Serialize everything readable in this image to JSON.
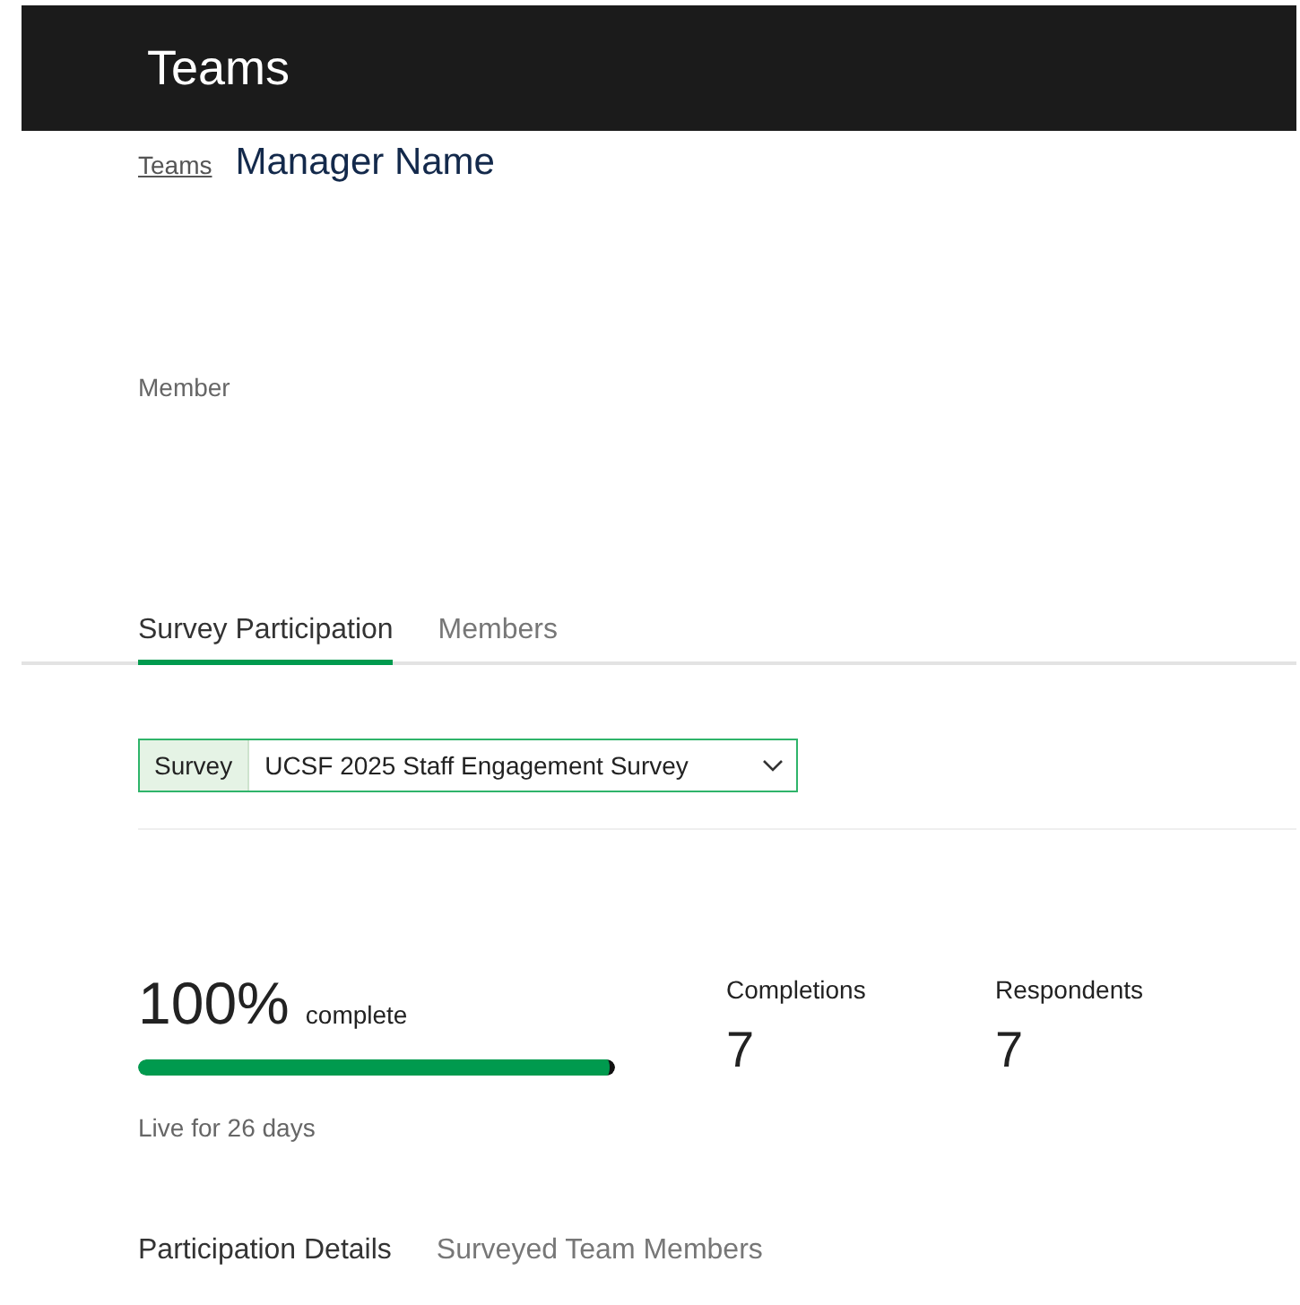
{
  "header": {
    "title": "Teams"
  },
  "breadcrumb": {
    "link": "Teams",
    "title": "Manager Name"
  },
  "member_label": "Member",
  "tabs": [
    {
      "label": "Survey Participation",
      "selected": true
    },
    {
      "label": "Members",
      "selected": false
    }
  ],
  "survey_select": {
    "label": "Survey",
    "value": "UCSF 2025 Staff Engagement Survey"
  },
  "progress": {
    "percent": "100%",
    "suffix": "complete",
    "level": 1,
    "live": "Live for 26 days"
  },
  "stats": [
    {
      "label": "Completions",
      "value": "7"
    },
    {
      "label": "Respondents",
      "value": "7"
    }
  ],
  "sub_tabs": [
    {
      "label": "Participation Details",
      "selected": true
    },
    {
      "label": "Surveyed Team Members",
      "selected": false
    }
  ]
}
